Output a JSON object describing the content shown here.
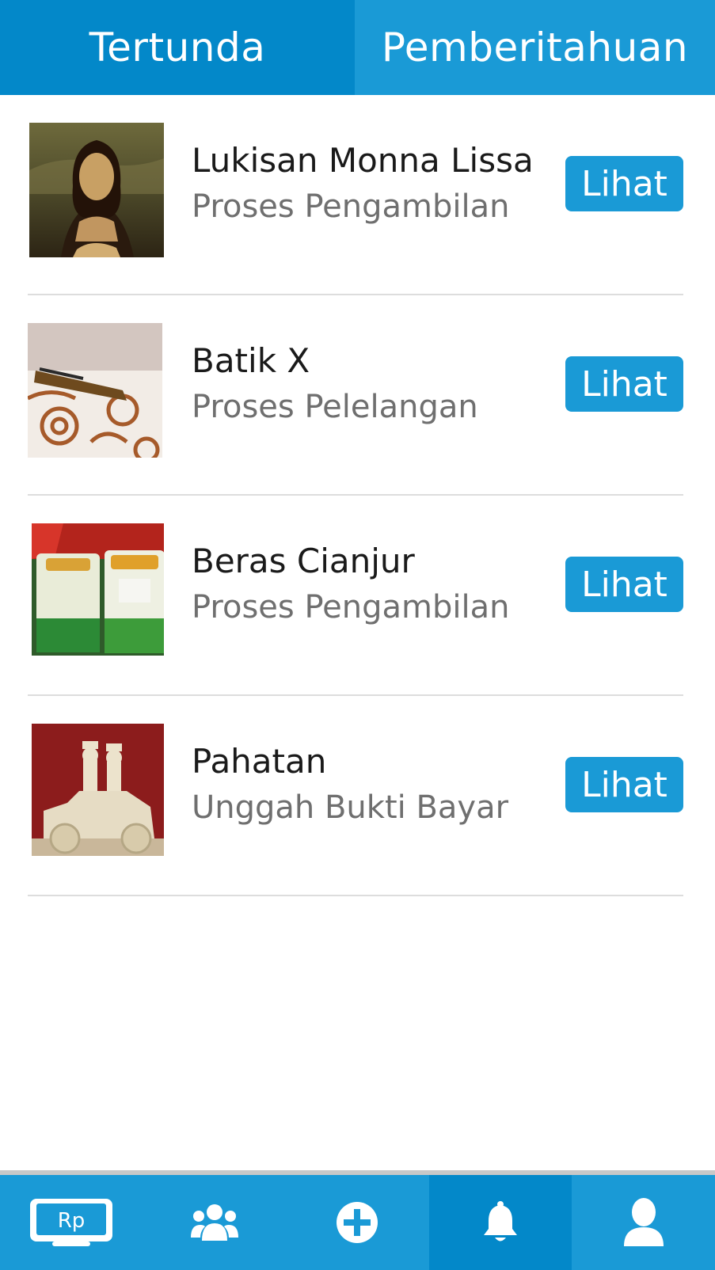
{
  "tabs": [
    {
      "label": "Tertunda",
      "active": true
    },
    {
      "label": "Pemberitahuan",
      "active": false
    }
  ],
  "items": [
    {
      "title": "Lukisan Monna Lissa",
      "status": "Proses Pengambilan",
      "button": "Lihat",
      "image": "mona-lisa-painting"
    },
    {
      "title": "Batik X",
      "status": "Proses Pelelangan",
      "button": "Lihat",
      "image": "batik-fabric"
    },
    {
      "title": "Beras Cianjur",
      "status": "Proses Pengambilan",
      "button": "Lihat",
      "image": "rice-sacks"
    },
    {
      "title": "Pahatan",
      "status": "Unggah Bukti Bayar",
      "button": "Lihat",
      "image": "carved-car-sculpture"
    }
  ],
  "nav": {
    "wallet_label": "Rp",
    "items": [
      {
        "icon": "wallet-screen-icon",
        "active": false
      },
      {
        "icon": "group-icon",
        "active": false
      },
      {
        "icon": "add-circle-icon",
        "active": false
      },
      {
        "icon": "bell-icon",
        "active": true
      },
      {
        "icon": "user-icon",
        "active": false
      }
    ]
  },
  "colors": {
    "primary": "#1a9ad6",
    "primary_dark": "#0388c9",
    "text": "#1a1a1a",
    "muted": "#6f6f6f"
  }
}
